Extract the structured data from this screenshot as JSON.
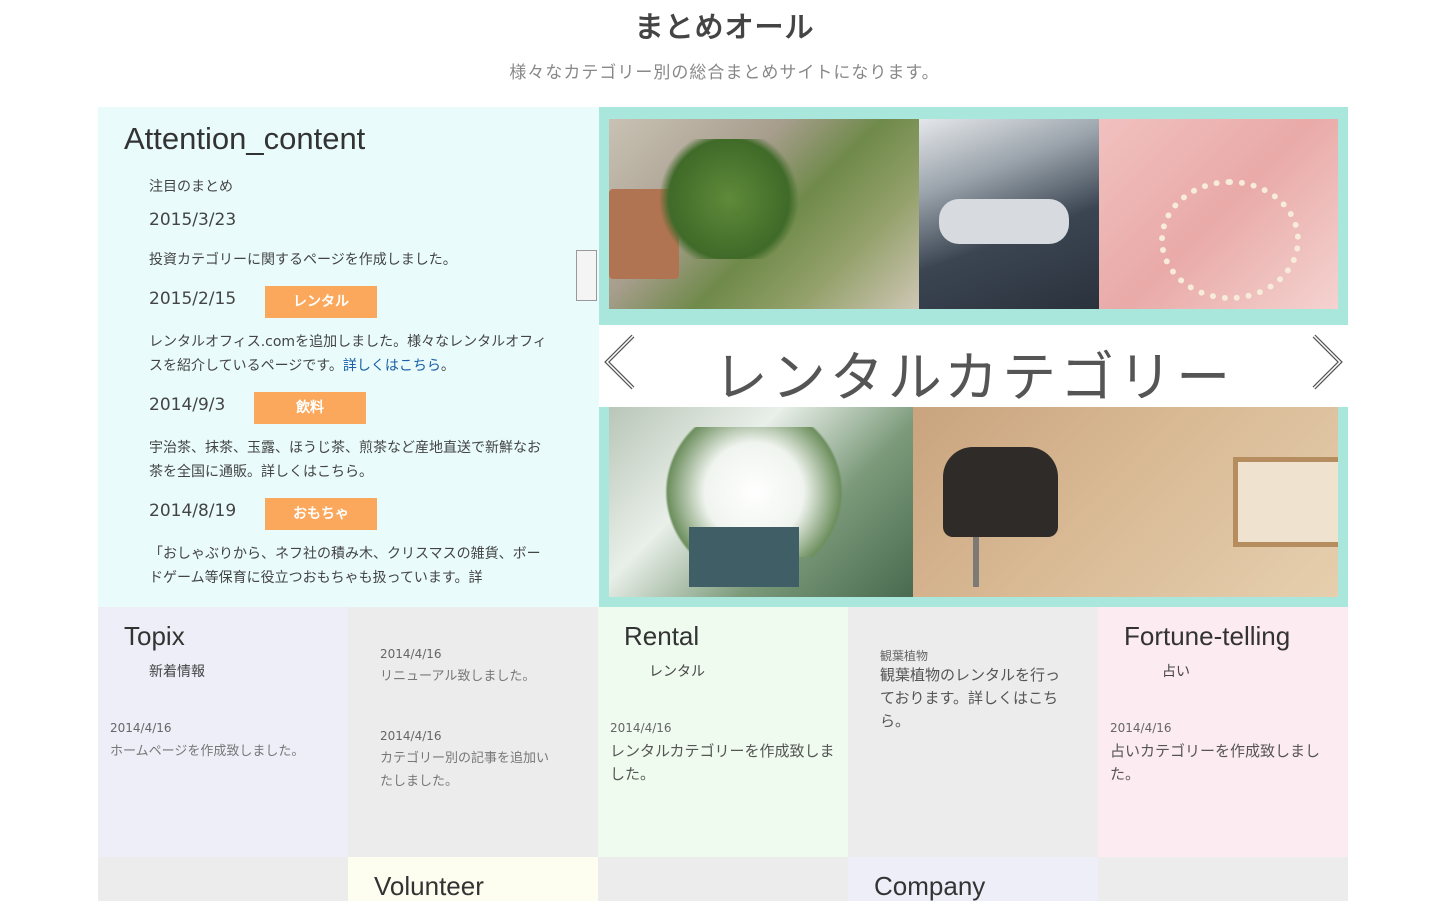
{
  "header": {
    "title": "まとめオール",
    "subtitle": "様々なカテゴリー別の総合まとめサイトになります。"
  },
  "attention": {
    "title": "Attention_content",
    "subtitle": "注目のまとめ",
    "news": [
      {
        "date": "2015/3/23",
        "tag": "",
        "text": "投資カテゴリーに関するページを作成しました。",
        "link": ""
      },
      {
        "date": "2015/2/15",
        "tag": "レンタル",
        "text": "レンタルオフィス.comを追加しました。様々なレンタルオフィスを紹介しているページです。",
        "link": "詳しくはこちら",
        "after_link": "。"
      },
      {
        "date": "2014/9/3",
        "tag": "飲料",
        "text": "宇治茶、抹茶、玉露、ほうじ茶、煎茶など産地直送で新鮮なお茶を全国に通販。詳しくはこちら。",
        "link": ""
      },
      {
        "date": "2014/8/19",
        "tag": "おもちゃ",
        "text": "「おしゃぶりから、ネフ社の積み木、クリスマスの雑貨、ボードゲーム等保育に役立つおもちゃも扱っています。詳",
        "link": ""
      }
    ],
    "tag_color": "#fba85c"
  },
  "slider": {
    "banner": "レンタルカテゴリー",
    "prev_icon": "chevron-left-icon",
    "next_icon": "chevron-right-icon",
    "frame_color": "#a9e6dc"
  },
  "tiles": {
    "topix": {
      "title": "Topix",
      "subtitle": "新着情報",
      "date": "2014/4/16",
      "text": "ホームページを作成致しました。"
    },
    "topix_more": {
      "date1": "2014/4/16",
      "text1": "リニューアル致しました。",
      "date2": "2014/4/16",
      "text2": "カテゴリー別の記事を追加いたしました。"
    },
    "rental": {
      "title": "Rental",
      "subtitle": "レンタル",
      "date": "2014/4/16",
      "text": "レンタルカテゴリーを作成致しました。"
    },
    "rental_more": {
      "label": "観葉植物",
      "text": "観葉植物のレンタルを行っております。詳しくはこちら。"
    },
    "fortune": {
      "title": "Fortune-telling",
      "subtitle": "占い",
      "date": "2014/4/16",
      "text": "占いカテゴリーを作成致しました。"
    },
    "volunteer": {
      "title": "Volunteer"
    },
    "company": {
      "title": "Company"
    }
  }
}
